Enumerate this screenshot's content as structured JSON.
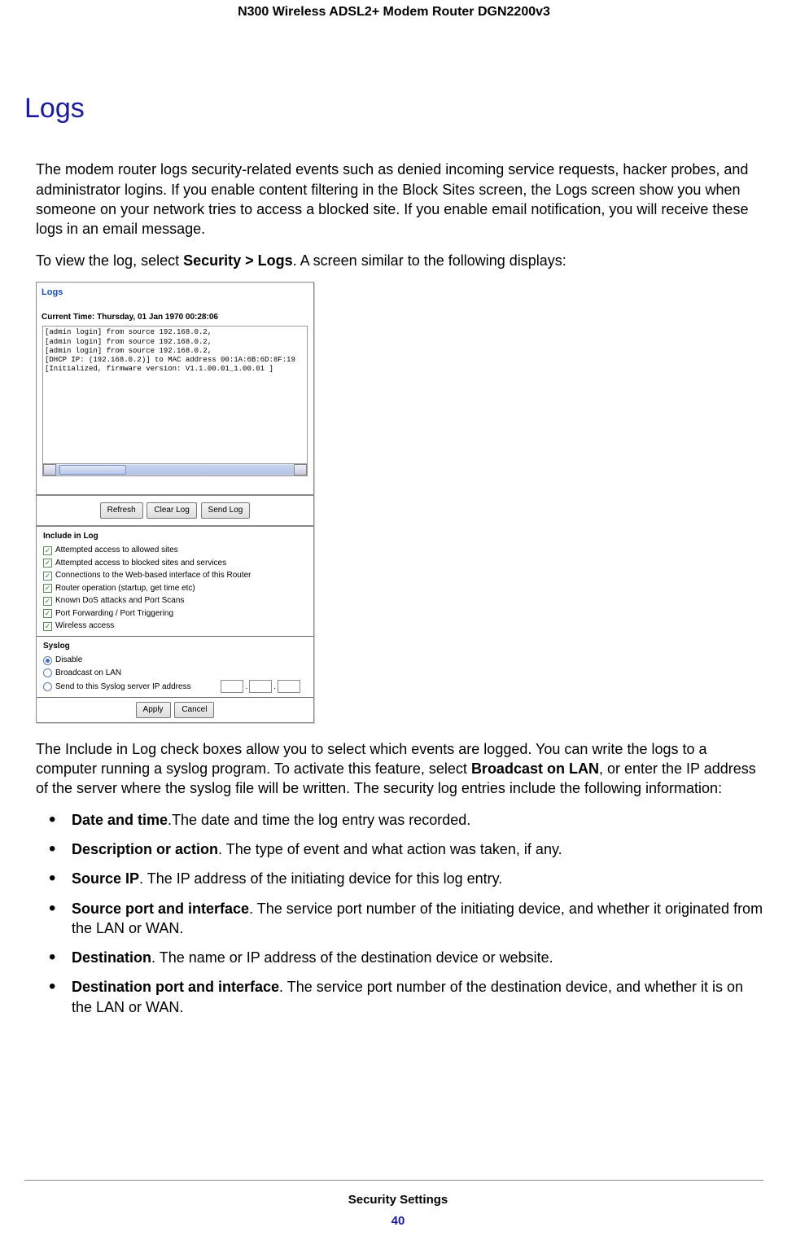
{
  "doc": {
    "header_title": "N300 Wireless ADSL2+ Modem Router DGN2200v3",
    "h1": "Logs",
    "p1": "The modem router logs security-related events such as denied incoming service requests, hacker probes, and administrator logins. If you enable content filtering in the Block Sites screen, the Logs screen show you when someone on your network tries to access a blocked site. If you enable email notification, you will receive these logs in an email message.",
    "p2_a": "To view the log, select ",
    "p2_b": "Security > Logs",
    "p2_c": ". A screen similar to the following displays:",
    "p3_a": "The Include in Log check boxes allow you to select which events are logged. You can write the logs to a computer running a syslog program. To activate this feature, select ",
    "p3_b": "Broadcast on LAN",
    "p3_c": ", or enter the IP address of the server where the syslog file will be written. The security log entries include the following information:"
  },
  "screenshot": {
    "title": "Logs",
    "current_time": "Current Time: Thursday, 01 Jan 1970 00:28:06",
    "log_lines": [
      "[admin login] from source 192.168.0.2,",
      "[admin login] from source 192.168.0.2,",
      "[admin login] from source 192.168.0.2,",
      "[DHCP IP: (192.168.0.2)] to MAC address 00:1A:6B:6D:8F:19",
      "[Initialized, firmware version: V1.1.00.01_1.00.01 ]"
    ],
    "buttons": {
      "refresh": "Refresh",
      "clear": "Clear Log",
      "send": "Send Log"
    },
    "include_head": "Include in Log",
    "includes": [
      "Attempted access to allowed sites",
      "Attempted access to blocked sites and services",
      "Connections to the Web-based interface of this Router",
      "Router operation (startup, get time etc)",
      "Known DoS attacks and Port Scans",
      "Port Forwarding / Port Triggering",
      "Wireless access"
    ],
    "syslog_head": "Syslog",
    "syslog": {
      "disable": "Disable",
      "broadcast": "Broadcast on LAN",
      "sendto": "Send to this Syslog server IP address"
    },
    "dot": ".",
    "apply": "Apply",
    "cancel": "Cancel"
  },
  "fields": {
    "f1_a": "Date and time",
    "f1_b": ".The date and time the log entry was recorded.",
    "f2_a": "Description or action",
    "f2_b": ". The type of event and what action was taken, if any.",
    "f3_a": "Source IP",
    "f3_b": ". The IP address of the initiating device for this log entry.",
    "f4_a": "Source port and interface",
    "f4_b": ". The service port number of the initiating device, and whether it originated from the LAN or WAN.",
    "f5_a": "Destination",
    "f5_b": ". The name or IP address of the destination device or website.",
    "f6_a": "Destination port and interface",
    "f6_b": ". The service port number of the destination device, and whether it is on the LAN or WAN."
  },
  "footer": {
    "section": "Security Settings",
    "page": "40"
  }
}
